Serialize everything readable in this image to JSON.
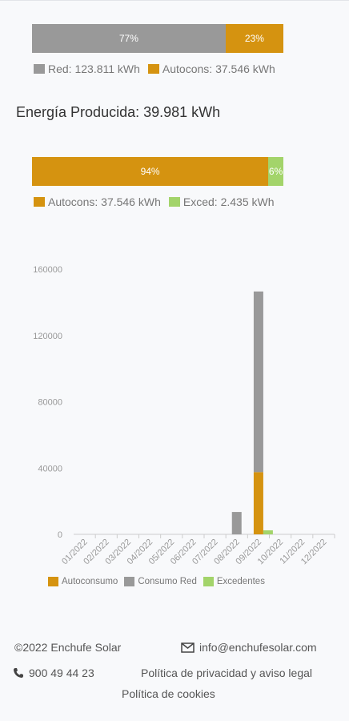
{
  "consumption_bar": {
    "segments": [
      {
        "label": "77%",
        "percent": 77,
        "color": "#999999"
      },
      {
        "label": "23%",
        "percent": 23,
        "color": "#d59310"
      }
    ],
    "legend": [
      {
        "text": "Red: 123.811 kWh",
        "color": "#999999"
      },
      {
        "text": "Autocons: 37.546 kWh",
        "color": "#d59310"
      }
    ]
  },
  "produced": {
    "title": "Energía Producida: 39.981 kWh"
  },
  "production_bar": {
    "segments": [
      {
        "label": "94%",
        "percent": 94,
        "color": "#d59310"
      },
      {
        "label": "6%",
        "percent": 6,
        "color": "#a3d46a"
      }
    ],
    "legend": [
      {
        "text": "Autocons: 37.546 kWh",
        "color": "#d59310"
      },
      {
        "text": "Exced: 2.435 kWh",
        "color": "#a3d46a"
      }
    ]
  },
  "chart_data": {
    "type": "bar",
    "stacked": true,
    "categories": [
      "01/2022",
      "02/2022",
      "03/2022",
      "04/2022",
      "05/2022",
      "06/2022",
      "07/2022",
      "08/2022",
      "09/2022",
      "10/2022",
      "11/2022",
      "12/2022"
    ],
    "series": [
      {
        "name": "Autoconsumo",
        "color": "#d59310",
        "values": [
          0,
          0,
          0,
          0,
          0,
          0,
          0,
          0,
          37546,
          0,
          0,
          0
        ]
      },
      {
        "name": "Consumo Red",
        "color": "#999999",
        "values": [
          0,
          0,
          0,
          0,
          0,
          0,
          0,
          13500,
          109000,
          0,
          0,
          0
        ]
      },
      {
        "name": "Excedentes",
        "color": "#a3d46a",
        "values": [
          0,
          0,
          0,
          0,
          0,
          0,
          0,
          0,
          2435,
          0,
          0,
          0
        ]
      }
    ],
    "y_ticks": [
      "0",
      "40000",
      "80000",
      "120000",
      "160000"
    ],
    "ylim": [
      0,
      160000
    ],
    "legend_placement": "bottom",
    "grid": false
  },
  "footer": {
    "copyright": "©2022 Enchufe Solar",
    "email": "info@enchufesolar.com",
    "phone": "900 49 44 23",
    "privacy": "Política de privacidad y aviso legal",
    "cookies": "Política de cookies"
  }
}
